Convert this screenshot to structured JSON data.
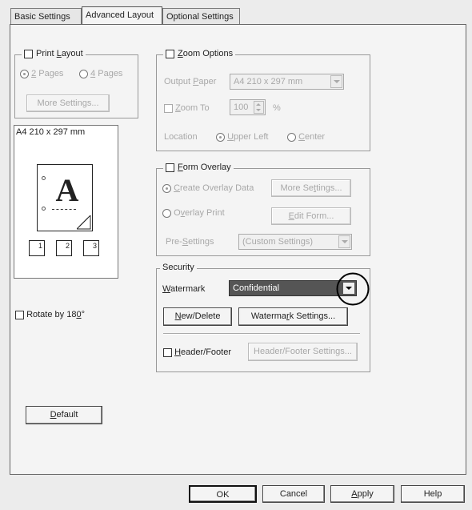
{
  "tabs": [
    "Basic Settings",
    "Advanced Layout",
    "Optional Settings"
  ],
  "print_layout": {
    "title_pre": "Print ",
    "title_ul": "L",
    "title_post": "ayout",
    "radio1_ul": "2",
    "radio1_post": " Pages",
    "radio2_ul": "4",
    "radio2_post": " Pages",
    "more_settings_label": "More Settings..."
  },
  "preview": {
    "paper_label": "A4 210 x 297 mm",
    "letter": "A",
    "page_icons": [
      "1",
      "2",
      "3"
    ]
  },
  "rotate": {
    "label_pre": "Rotate by 18",
    "label_ul": "0",
    "label_post": "°"
  },
  "default_button": {
    "ul": "D",
    "post": "efault"
  },
  "zoom_options": {
    "title_ul": "Z",
    "title_post": "oom Options",
    "output_paper_pre": "Output ",
    "output_paper_ul": "P",
    "output_paper_post": "aper",
    "output_paper_value": "A4 210 x 297 mm",
    "zoom_to_ul": "Z",
    "zoom_to_post": "oom To",
    "zoom_value": "100",
    "percent": "%",
    "location_label": "Location",
    "upper_left_ul": "U",
    "upper_left_post": "pper Left",
    "center_ul": "C",
    "center_post": "enter"
  },
  "form_overlay": {
    "title_ul": "F",
    "title_post": "orm Overlay",
    "create_ul": "C",
    "create_post": "reate Overlay Data",
    "more_settings_pre": "More Se",
    "more_settings_ul": "t",
    "more_settings_post": "tings...",
    "overlay_pre": "O",
    "overlay_ul": "v",
    "overlay_post": "erlay Print",
    "edit_form_pre": "",
    "edit_form_ul": "E",
    "edit_form_post": "dit Form...",
    "pre_settings_pre": "Pre-",
    "pre_settings_ul": "S",
    "pre_settings_post": "ettings",
    "pre_settings_value": "(Custom Settings)"
  },
  "security": {
    "title": "Security",
    "watermark_ul": "W",
    "watermark_post": "atermark",
    "watermark_value": "Confidential",
    "new_delete_ul": "N",
    "new_delete_post": "ew/Delete",
    "watermark_settings_pre": "Waterma",
    "watermark_settings_ul": "r",
    "watermark_settings_post": "k Settings...",
    "header_footer_ul": "H",
    "header_footer_post": "eader/Footer",
    "header_footer_settings_label": "Header/Footer Settings..."
  },
  "bottom_buttons": {
    "ok": "OK",
    "cancel": "Cancel",
    "apply_ul": "A",
    "apply_post": "pply",
    "help": "Help"
  },
  "colors": {
    "combo_selected": "#555555",
    "highlight_circle": "#000000"
  }
}
